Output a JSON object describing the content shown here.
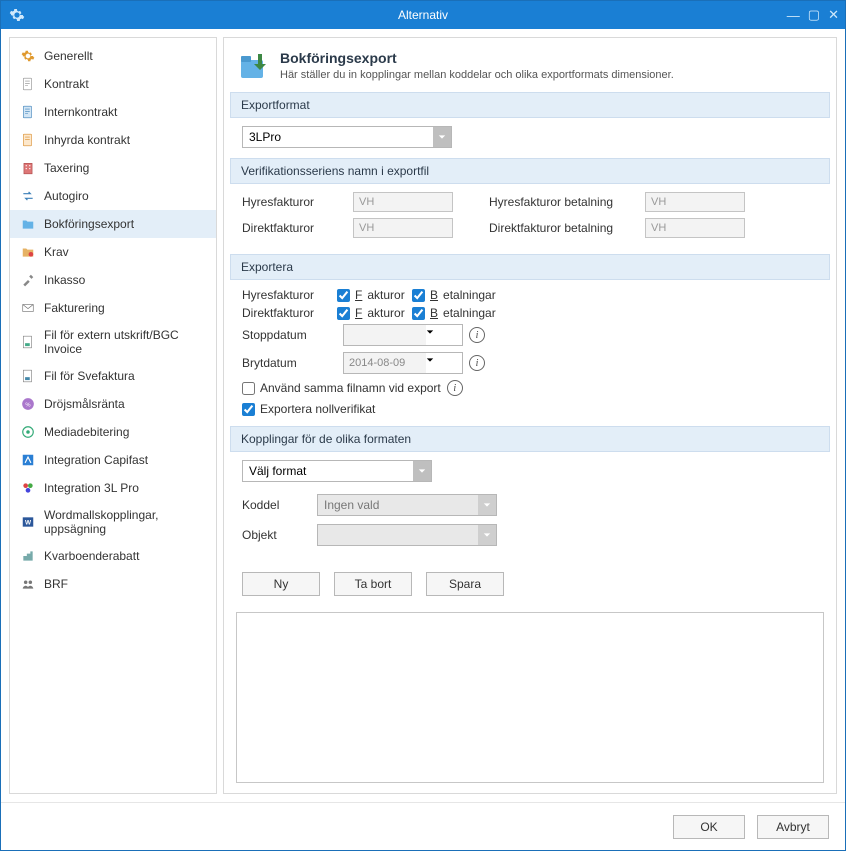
{
  "window": {
    "title": "Alternativ"
  },
  "sidebar": {
    "items": [
      {
        "label": "Generellt",
        "icon": "gear"
      },
      {
        "label": "Kontrakt",
        "icon": "doc"
      },
      {
        "label": "Internkontrakt",
        "icon": "doc-blue"
      },
      {
        "label": "Inhyrda kontrakt",
        "icon": "doc-orange"
      },
      {
        "label": "Taxering",
        "icon": "building"
      },
      {
        "label": "Autogiro",
        "icon": "arrows"
      },
      {
        "label": "Bokföringsexport",
        "icon": "folder-blue",
        "selected": true
      },
      {
        "label": "Krav",
        "icon": "folder-red"
      },
      {
        "label": "Inkasso",
        "icon": "hammer"
      },
      {
        "label": "Fakturering",
        "icon": "envelope"
      },
      {
        "label": "Fil för extern utskrift/BGC Invoice",
        "icon": "file-print"
      },
      {
        "label": "Fil för Svefaktura",
        "icon": "file-sve"
      },
      {
        "label": "Dröjsmålsränta",
        "icon": "percent"
      },
      {
        "label": "Mediadebitering",
        "icon": "media"
      },
      {
        "label": "Integration Capifast",
        "icon": "int-cap"
      },
      {
        "label": "Integration 3L Pro",
        "icon": "int-3l"
      },
      {
        "label": "Wordmallskopplingar, uppsägning",
        "icon": "word"
      },
      {
        "label": "Kvarboenderabatt",
        "icon": "discount"
      },
      {
        "label": "BRF",
        "icon": "group"
      }
    ]
  },
  "header": {
    "title": "Bokföringsexport",
    "subtitle": "Här ställer du in kopplingar mellan koddelar och olika exportformats dimensioner."
  },
  "sections": {
    "exportformat": {
      "title": "Exportformat",
      "selected": "3LPro"
    },
    "verifikation": {
      "title": "Verifikationsseriens namn i exportfil",
      "hyresfakturor_label": "Hyresfakturor",
      "hyresfakturor_value": "VH",
      "hyresfakturor_bet_label": "Hyresfakturor betalning",
      "hyresfakturor_bet_value": "VH",
      "direktfakturor_label": "Direktfakturor",
      "direktfakturor_value": "VH",
      "direktfakturor_bet_label": "Direktfakturor betalning",
      "direktfakturor_bet_value": "VH"
    },
    "exportera": {
      "title": "Exportera",
      "hyresfakturor_label": "Hyresfakturor",
      "direktfakturor_label": "Direktfakturor",
      "fakturor_label": "Fakturor",
      "betalningar_label": "Betalningar",
      "stoppdatum_label": "Stoppdatum",
      "stoppdatum_value": "",
      "brytdatum_label": "Brytdatum",
      "brytdatum_value": "2014-08-09",
      "same_filename_label": "Använd samma filnamn vid export",
      "export_noll_label": "Exportera nollverifikat"
    },
    "kopplingar": {
      "title": "Kopplingar för de olika formaten",
      "format_label": "Välj format",
      "koddel_label": "Koddel",
      "koddel_value": "Ingen vald",
      "objekt_label": "Objekt",
      "objekt_value": "",
      "btn_ny": "Ny",
      "btn_tabort": "Ta bort",
      "btn_spara": "Spara"
    }
  },
  "footer": {
    "ok": "OK",
    "avbryt": "Avbryt"
  }
}
